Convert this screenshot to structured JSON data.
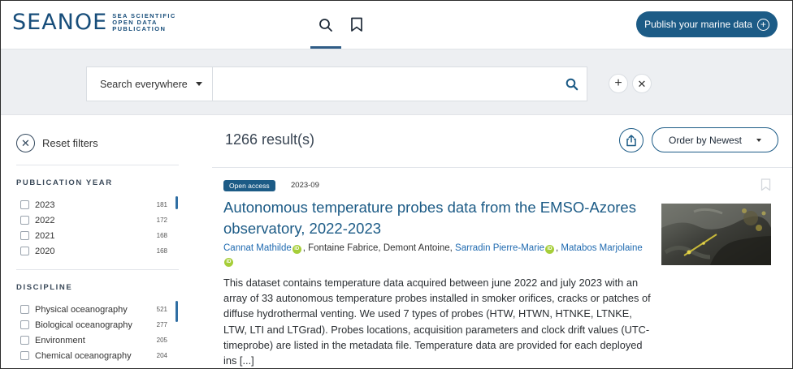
{
  "header": {
    "logo_word": "SEANOE",
    "logo_lines": [
      "SEA SCIENTIFIC",
      "OPEN DATA",
      "PUBLICATION"
    ],
    "publish_label": "Publish your marine data",
    "nav": [
      "search-icon",
      "bookmark-icon"
    ]
  },
  "search": {
    "scope_label": "Search everywhere",
    "query_value": "",
    "placeholder": ""
  },
  "sidebar": {
    "reset_label": "Reset filters",
    "facets": [
      {
        "title": "PUBLICATION YEAR",
        "items": [
          {
            "label": "2023",
            "count": "181"
          },
          {
            "label": "2022",
            "count": "172"
          },
          {
            "label": "2021",
            "count": "168"
          },
          {
            "label": "2020",
            "count": "168"
          }
        ]
      },
      {
        "title": "DISCIPLINE",
        "items": [
          {
            "label": "Physical oceanography",
            "count": "521"
          },
          {
            "label": "Biological oceanography",
            "count": "277"
          },
          {
            "label": "Environment",
            "count": "205"
          },
          {
            "label": "Chemical oceanography",
            "count": "204"
          }
        ]
      }
    ]
  },
  "results": {
    "count_label": "1266 result(s)",
    "order_label": "Order by Newest",
    "item": {
      "badge": "Open access",
      "date": "2023-09",
      "title": "Autonomous temperature probes data from the EMSO-Azores observatory, 2022-2023",
      "authors": {
        "a1": "Cannat Mathilde",
        "plain": ", Fontaine Fabrice, Demont Antoine, ",
        "a2": "Sarradin Pierre-Marie",
        "a3": "Matabos Marjolaine",
        "orcid_mark": "iD"
      },
      "description": "This dataset contains temperature data acquired between june 2022 and july 2023 with an array of 33 autonomous temperature probes installed in smoker orifices, cracks or patches of diffuse hydrothermal venting. We used 7 types of probes (HTW, HTWN, HTNKE, LTNKE, LTW, LTI and LTGrad). Probes locations, acquisition parameters and clock drift values (UTC-timeprobe) are listed in the metadata file. Temperature data are provided for each deployed ins [...]"
    }
  },
  "colors": {
    "brand": "#1c5b86",
    "link": "#1f6ab0",
    "orcid": "#a6ce39",
    "band": "#edeff2"
  }
}
